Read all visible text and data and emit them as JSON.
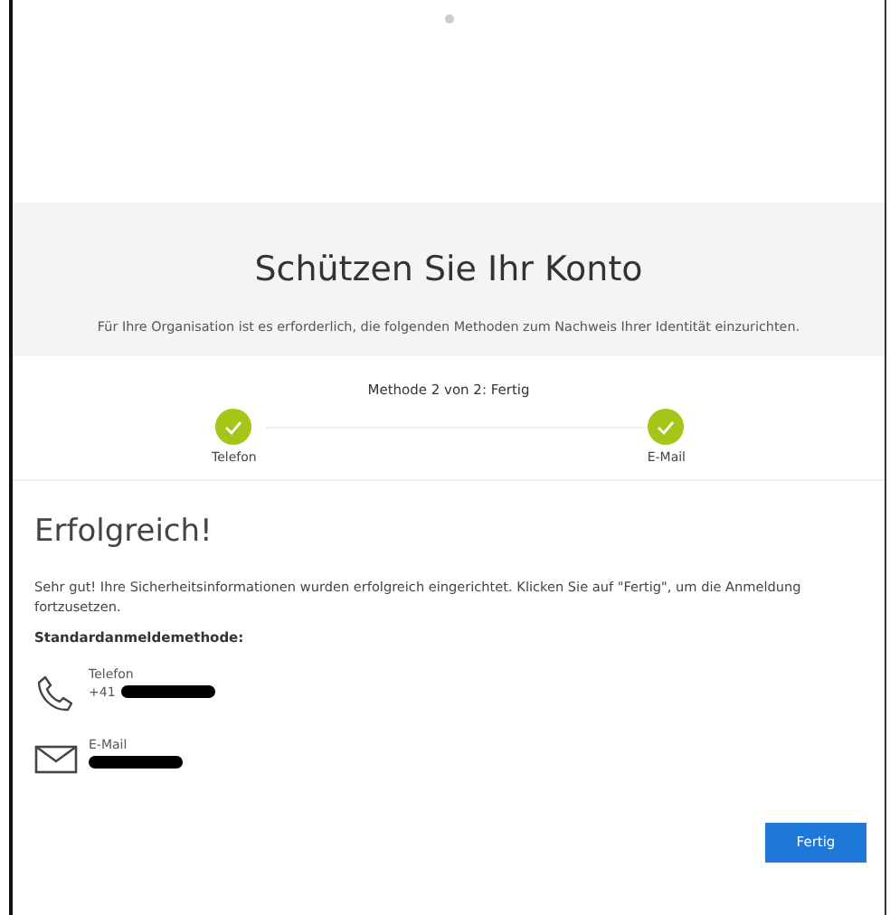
{
  "header": {
    "title": "Schützen Sie Ihr Konto",
    "subtitle": "Für Ihre Organisation ist es erforderlich, die folgenden Methoden zum Nachweis Ihrer Identität einzurichten."
  },
  "progress": {
    "caption": "Methode 2 von 2: Fertig",
    "steps": [
      {
        "label": "Telefon",
        "completed": true
      },
      {
        "label": "E-Mail",
        "completed": true
      }
    ]
  },
  "result": {
    "title": "Erfolgreich!",
    "message": "Sehr gut! Ihre Sicherheitsinformationen wurden erfolgreich eingerichtet. Klicken Sie auf \"Fertig\", um die Anmeldung fortzusetzen.",
    "default_label": "Standardanmeldemethode:"
  },
  "methods": [
    {
      "kind": "phone",
      "label": "Telefon",
      "value": "+41",
      "redacted": true
    },
    {
      "kind": "email",
      "label": "E-Mail",
      "redacted": true
    }
  ],
  "buttons": [
    {
      "label": "Fertig"
    }
  ]
}
